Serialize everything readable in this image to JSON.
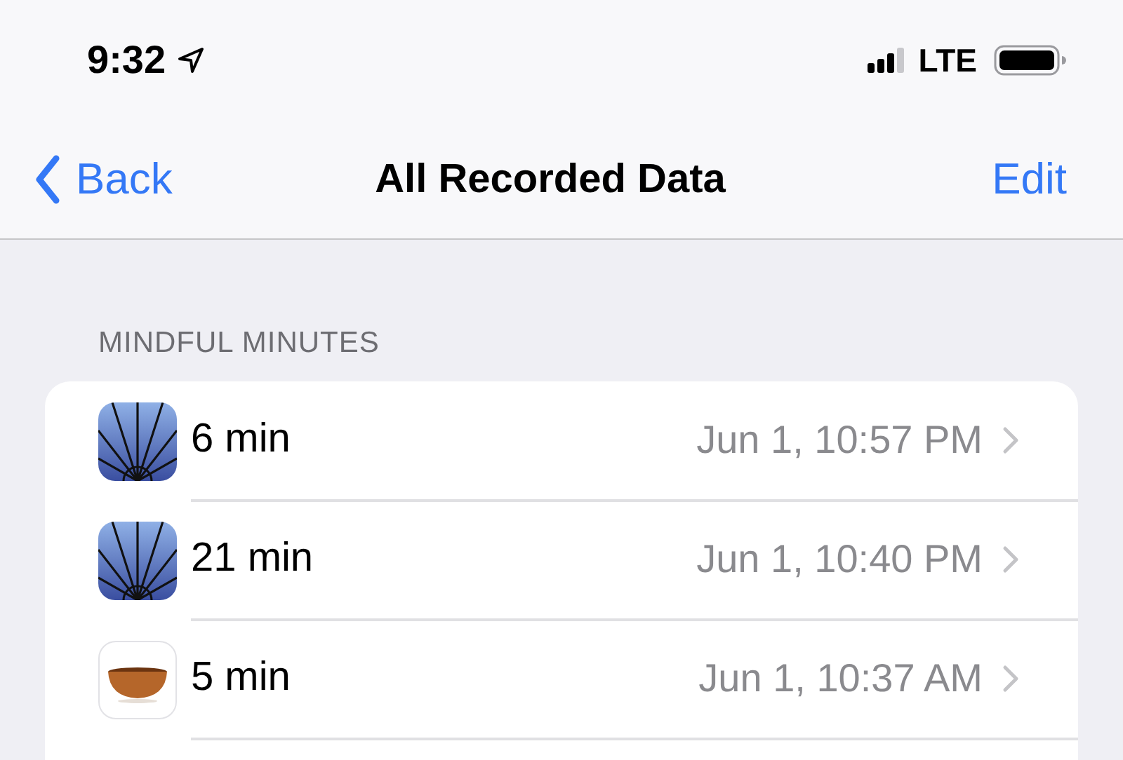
{
  "status_bar": {
    "time": "9:32",
    "network": "LTE"
  },
  "nav": {
    "back": "Back",
    "title": "All Recorded Data",
    "action": "Edit"
  },
  "section": {
    "header": "MINDFUL MINUTES",
    "rows": [
      {
        "kind": "sunburst",
        "value": "6 min",
        "date": "Jun 1, 10:57 PM"
      },
      {
        "kind": "sunburst",
        "value": "21 min",
        "date": "Jun 1, 10:40 PM"
      },
      {
        "kind": "bowl",
        "value": "5 min",
        "date": "Jun 1, 10:37 AM"
      }
    ]
  }
}
